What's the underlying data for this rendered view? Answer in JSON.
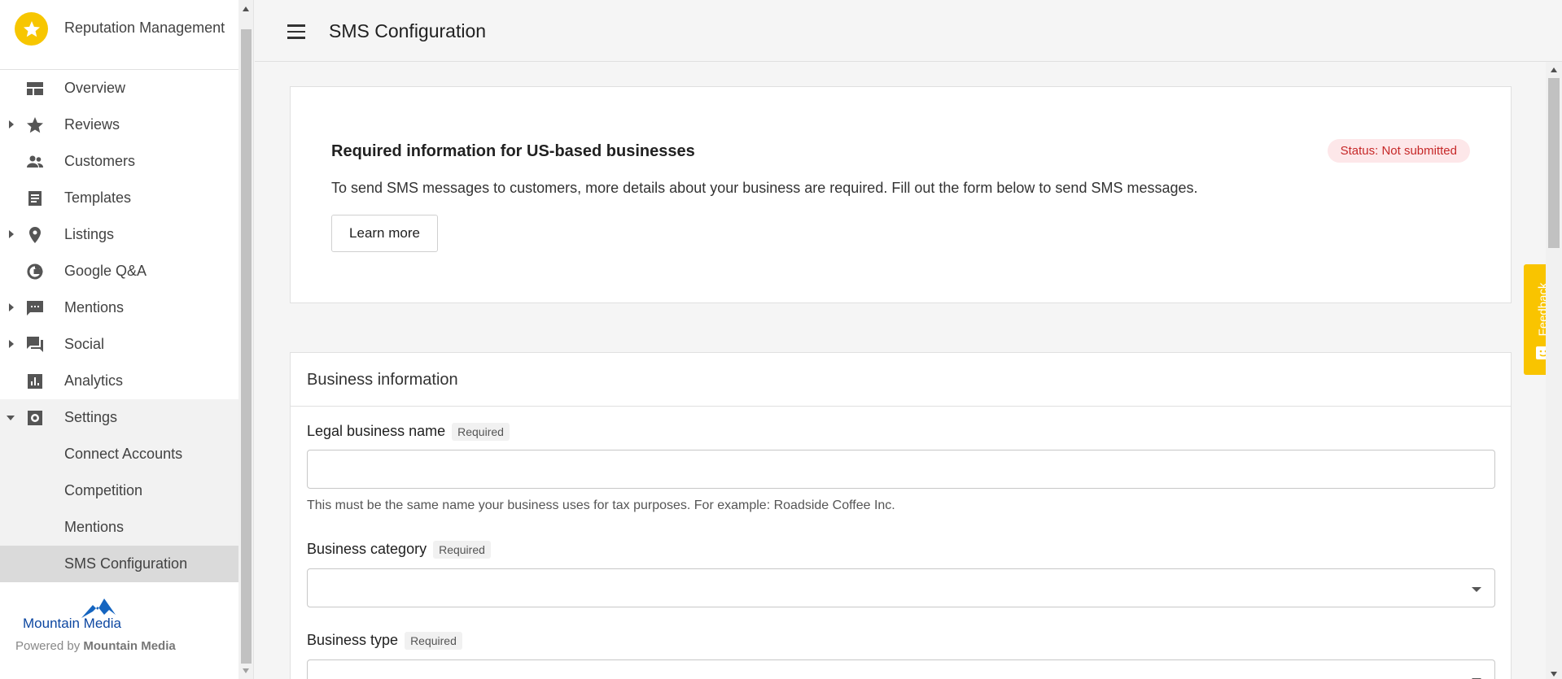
{
  "app": {
    "title": "Reputation Management"
  },
  "sidebar": {
    "items": [
      {
        "label": "Overview",
        "icon": "dashboard-icon",
        "expandable": false
      },
      {
        "label": "Reviews",
        "icon": "star-icon",
        "expandable": true
      },
      {
        "label": "Customers",
        "icon": "people-icon",
        "expandable": false
      },
      {
        "label": "Templates",
        "icon": "document-icon",
        "expandable": false
      },
      {
        "label": "Listings",
        "icon": "location-pin-icon",
        "expandable": true
      },
      {
        "label": "Google Q&A",
        "icon": "google-icon",
        "expandable": false
      },
      {
        "label": "Mentions",
        "icon": "chat-bubble-icon",
        "expandable": true
      },
      {
        "label": "Social",
        "icon": "forum-icon",
        "expandable": true
      },
      {
        "label": "Analytics",
        "icon": "bar-chart-icon",
        "expandable": false
      }
    ],
    "settings": {
      "label": "Settings",
      "icon": "gear-icon",
      "expanded": true,
      "children": [
        {
          "label": "Connect Accounts"
        },
        {
          "label": "Competition"
        },
        {
          "label": "Mentions"
        },
        {
          "label": "SMS Configuration",
          "active": true
        }
      ]
    },
    "brand": {
      "logo_text": "Mountain Media",
      "powered_prefix": "Powered by",
      "powered_name": "Mountain Media"
    }
  },
  "header": {
    "title": "SMS Configuration"
  },
  "notice_card": {
    "heading": "Required information for US-based businesses",
    "status": "Status: Not submitted",
    "description": "To send SMS messages to customers, more details about your business are required. Fill out the form below to send SMS messages.",
    "button_label": "Learn more"
  },
  "business_info": {
    "section_title": "Business information",
    "fields": {
      "legal_name": {
        "label": "Legal business name",
        "tag": "Required",
        "value": "",
        "hint": "This must be the same name your business uses for tax purposes. For example: Roadside Coffee Inc."
      },
      "category": {
        "label": "Business category",
        "tag": "Required",
        "value": ""
      },
      "type": {
        "label": "Business type",
        "tag": "Required",
        "value": ""
      }
    }
  },
  "feedback": {
    "label": "Feedback"
  },
  "colors": {
    "accent": "#f7c600",
    "status_bg": "#fde7e9",
    "status_text": "#c62828",
    "active_nav": "#dadada"
  }
}
